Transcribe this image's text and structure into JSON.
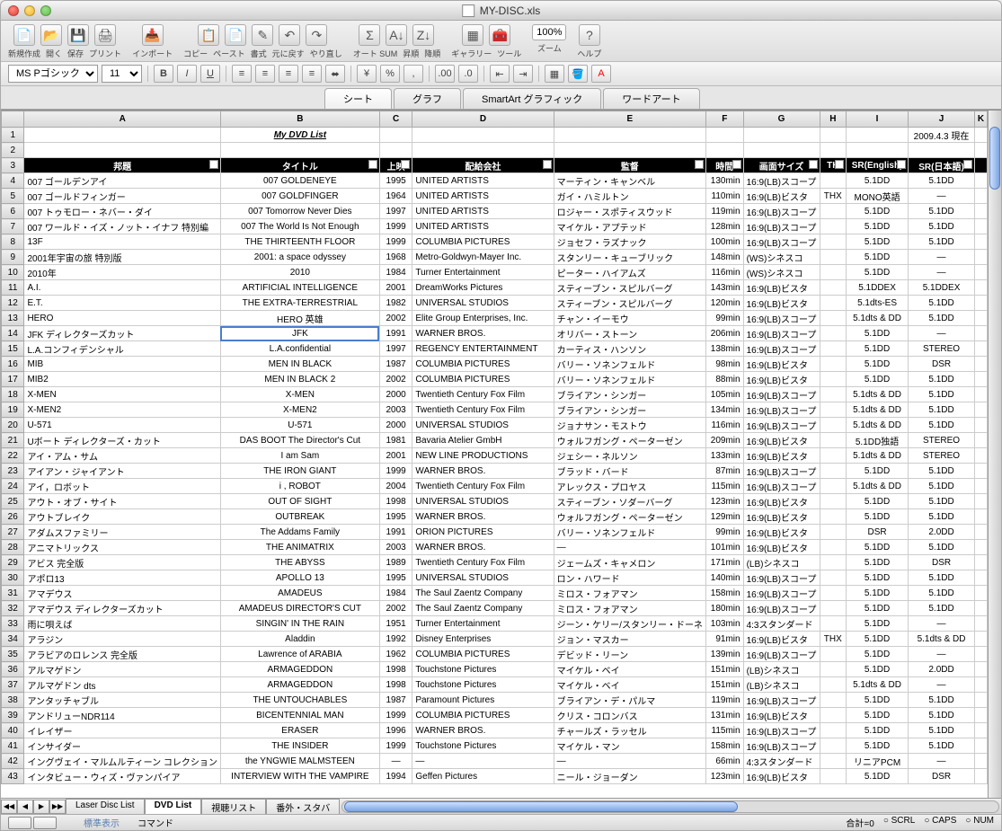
{
  "window": {
    "title": "MY-DISC.xls"
  },
  "toolbar": {
    "groups": [
      {
        "labels": [
          "新規作成",
          "開く",
          "保存",
          "プリント"
        ],
        "keys": [
          "new",
          "open",
          "save",
          "print"
        ]
      },
      {
        "labels": [
          "インポート"
        ],
        "keys": [
          "import"
        ]
      },
      {
        "labels": [
          "コピー",
          "ペースト",
          "書式",
          "元に戻す",
          "やり直し"
        ],
        "keys": [
          "copy",
          "paste",
          "format",
          "undo",
          "redo"
        ]
      },
      {
        "labels": [
          "オート SUM",
          "昇順",
          "降順"
        ],
        "keys": [
          "autosum",
          "asc",
          "desc"
        ]
      },
      {
        "labels": [
          "ギャラリー",
          "ツール"
        ],
        "keys": [
          "gallery",
          "tools"
        ]
      },
      {
        "labels": [
          "ズーム"
        ],
        "keys": [
          "zoom"
        ]
      },
      {
        "labels": [
          "ヘルプ"
        ],
        "keys": [
          "help"
        ]
      }
    ],
    "zoom": "100%"
  },
  "font": {
    "name": "MS Pゴシック",
    "size": "11"
  },
  "ribbontabs": [
    "シート",
    "グラフ",
    "SmartArt グラフィック",
    "ワードアート"
  ],
  "columns": [
    "",
    "A",
    "B",
    "C",
    "D",
    "E",
    "F",
    "G",
    "H",
    "I",
    "J",
    "K"
  ],
  "list_title": "My DVD List",
  "date": "2009.4.3 現在",
  "headers": [
    "邦題",
    "タイトル",
    "上映",
    "配給会社",
    "監督",
    "時間",
    "画面サイズ",
    "TH",
    "SR(English)",
    "SR(日本語)"
  ],
  "selected": {
    "row": 14,
    "col": "B"
  },
  "rows": [
    {
      "n": 4,
      "a": "007 ゴールデンアイ",
      "b": "007 GOLDENEYE",
      "c": "1995",
      "d": "UNITED ARTISTS",
      "e": "マーティン・キャンベル",
      "f": "130min",
      "g": "16:9(LB)スコープ",
      "h": "",
      "i": "5.1DD",
      "j": "5.1DD"
    },
    {
      "n": 5,
      "a": "007 ゴールドフィンガー",
      "b": "007 GOLDFINGER",
      "c": "1964",
      "d": "UNITED ARTISTS",
      "e": "ガイ・ハミルトン",
      "f": "110min",
      "g": "16:9(LB)ビスタ",
      "h": "THX",
      "i": "MONO英語",
      "j": "―"
    },
    {
      "n": 6,
      "a": "007 トゥモロー・ネバー・ダイ",
      "b": "007 Tomorrow Never Dies",
      "c": "1997",
      "d": "UNITED ARTISTS",
      "e": "ロジャー・スポティスウッド",
      "f": "119min",
      "g": "16:9(LB)スコープ",
      "h": "",
      "i": "5.1DD",
      "j": "5.1DD"
    },
    {
      "n": 7,
      "a": "007 ワールド・イズ・ノット・イナフ 特別編",
      "b": "007 The World Is Not Enough",
      "c": "1999",
      "d": "UNITED ARTISTS",
      "e": "マイケル・アプテッド",
      "f": "128min",
      "g": "16:9(LB)スコープ",
      "h": "",
      "i": "5.1DD",
      "j": "5.1DD"
    },
    {
      "n": 8,
      "a": "13F",
      "b": "THE THIRTEENTH FLOOR",
      "c": "1999",
      "d": "COLUMBIA PICTURES",
      "e": "ジョセフ・ラズナック",
      "f": "100min",
      "g": "16:9(LB)スコープ",
      "h": "",
      "i": "5.1DD",
      "j": "5.1DD"
    },
    {
      "n": 9,
      "a": "2001年宇宙の旅 特別版",
      "b": "2001: a space odyssey",
      "c": "1968",
      "d": "Metro-Goldwyn-Mayer Inc.",
      "e": "スタンリー・キューブリック",
      "f": "148min",
      "g": "(WS)シネスコ",
      "h": "",
      "i": "5.1DD",
      "j": "―"
    },
    {
      "n": 10,
      "a": "2010年",
      "b": "2010",
      "c": "1984",
      "d": "Turner Entertainment",
      "e": "ピーター・ハイアムズ",
      "f": "116min",
      "g": "(WS)シネスコ",
      "h": "",
      "i": "5.1DD",
      "j": "―"
    },
    {
      "n": 11,
      "a": "A.I.",
      "b": "ARTIFICIAL INTELLIGENCE",
      "c": "2001",
      "d": "DreamWorks Pictures",
      "e": "スティーブン・スピルバーグ",
      "f": "143min",
      "g": "16:9(LB)ビスタ",
      "h": "",
      "i": "5.1DDEX",
      "j": "5.1DDEX"
    },
    {
      "n": 12,
      "a": "E.T.",
      "b": "THE EXTRA-TERRESTRIAL",
      "c": "1982",
      "d": "UNIVERSAL STUDIOS",
      "e": "スティーブン・スピルバーグ",
      "f": "120min",
      "g": "16:9(LB)ビスタ",
      "h": "",
      "i": "5.1dts-ES",
      "j": "5.1DD"
    },
    {
      "n": 13,
      "a": "HERO",
      "b": "HERO 英雄",
      "c": "2002",
      "d": "Elite Group Enterprises, Inc.",
      "e": "チャン・イーモウ",
      "f": "99min",
      "g": "16:9(LB)スコープ",
      "h": "",
      "i": "5.1dts & DD",
      "j": "5.1DD"
    },
    {
      "n": 14,
      "a": "JFK ディレクターズカット",
      "b": "JFK",
      "c": "1991",
      "d": "WARNER BROS.",
      "e": "オリバー・ストーン",
      "f": "206min",
      "g": "16:9(LB)スコープ",
      "h": "",
      "i": "5.1DD",
      "j": "―"
    },
    {
      "n": 15,
      "a": "L.A.コンフィデンシャル",
      "b": "L.A.confidential",
      "c": "1997",
      "d": "REGENCY ENTERTAINMENT",
      "e": "カーティス・ハンソン",
      "f": "138min",
      "g": "16:9(LB)スコープ",
      "h": "",
      "i": "5.1DD",
      "j": "STEREO"
    },
    {
      "n": 16,
      "a": "MIB",
      "b": "MEN IN BLACK",
      "c": "1987",
      "d": "COLUMBIA PICTURES",
      "e": "バリー・ソネンフェルド",
      "f": "98min",
      "g": "16:9(LB)ビスタ",
      "h": "",
      "i": "5.1DD",
      "j": "DSR"
    },
    {
      "n": 17,
      "a": "MIB2",
      "b": "MEN IN BLACK 2",
      "c": "2002",
      "d": "COLUMBIA PICTURES",
      "e": "バリー・ソネンフェルド",
      "f": "88min",
      "g": "16:9(LB)ビスタ",
      "h": "",
      "i": "5.1DD",
      "j": "5.1DD"
    },
    {
      "n": 18,
      "a": "X-MEN",
      "b": "X-MEN",
      "c": "2000",
      "d": "Twentieth Century Fox Film",
      "e": "ブライアン・シンガー",
      "f": "105min",
      "g": "16:9(LB)スコープ",
      "h": "",
      "i": "5.1dts & DD",
      "j": "5.1DD"
    },
    {
      "n": 19,
      "a": "X-MEN2",
      "b": "X-MEN2",
      "c": "2003",
      "d": "Twentieth Century Fox Film",
      "e": "ブライアン・シンガー",
      "f": "134min",
      "g": "16:9(LB)スコープ",
      "h": "",
      "i": "5.1dts & DD",
      "j": "5.1DD"
    },
    {
      "n": 20,
      "a": "U-571",
      "b": "U-571",
      "c": "2000",
      "d": "UNIVERSAL STUDIOS",
      "e": "ジョナサン・モストウ",
      "f": "116min",
      "g": "16:9(LB)スコープ",
      "h": "",
      "i": "5.1dts & DD",
      "j": "5.1DD"
    },
    {
      "n": 21,
      "a": "Uボート ディレクターズ・カット",
      "b": "DAS BOOT The Director's Cut",
      "c": "1981",
      "d": "Bavaria Atelier GmbH",
      "e": "ウォルフガング・ペーターゼン",
      "f": "209min",
      "g": "16:9(LB)ビスタ",
      "h": "",
      "i": "5.1DD独語",
      "j": "STEREO"
    },
    {
      "n": 22,
      "a": "アイ・アム・サム",
      "b": "I am Sam",
      "c": "2001",
      "d": "NEW LINE PRODUCTIONS",
      "e": "ジェシー・ネルソン",
      "f": "133min",
      "g": "16:9(LB)ビスタ",
      "h": "",
      "i": "5.1dts & DD",
      "j": "STEREO"
    },
    {
      "n": 23,
      "a": "アイアン・ジャイアント",
      "b": "THE IRON GIANT",
      "c": "1999",
      "d": "WARNER BROS.",
      "e": "ブラッド・バード",
      "f": "87min",
      "g": "16:9(LB)スコープ",
      "h": "",
      "i": "5.1DD",
      "j": "5.1DD"
    },
    {
      "n": 24,
      "a": "アイ，ロボット",
      "b": "i , ROBOT",
      "c": "2004",
      "d": "Twentieth Century Fox Film",
      "e": "アレックス・プロヤス",
      "f": "115min",
      "g": "16:9(LB)スコープ",
      "h": "",
      "i": "5.1dts & DD",
      "j": "5.1DD"
    },
    {
      "n": 25,
      "a": "アウト・オブ・サイト",
      "b": "OUT OF SIGHT",
      "c": "1998",
      "d": "UNIVERSAL STUDIOS",
      "e": "スティーブン・ソダーバーグ",
      "f": "123min",
      "g": "16:9(LB)ビスタ",
      "h": "",
      "i": "5.1DD",
      "j": "5.1DD"
    },
    {
      "n": 26,
      "a": "アウトブレイク",
      "b": "OUTBREAK",
      "c": "1995",
      "d": "WARNER BROS.",
      "e": "ウォルフガング・ペーターゼン",
      "f": "129min",
      "g": "16:9(LB)ビスタ",
      "h": "",
      "i": "5.1DD",
      "j": "5.1DD"
    },
    {
      "n": 27,
      "a": "アダムスファミリー",
      "b": "The Addams Family",
      "c": "1991",
      "d": "ORION PICTURES",
      "e": "バリー・ソネンフェルド",
      "f": "99min",
      "g": "16:9(LB)ビスタ",
      "h": "",
      "i": "DSR",
      "j": "2.0DD"
    },
    {
      "n": 28,
      "a": "アニマトリックス",
      "b": "THE ANIMATRIX",
      "c": "2003",
      "d": "WARNER BROS.",
      "e": "―",
      "f": "101min",
      "g": "16:9(LB)ビスタ",
      "h": "",
      "i": "5.1DD",
      "j": "5.1DD"
    },
    {
      "n": 29,
      "a": "アビス 完全版",
      "b": "THE ABYSS",
      "c": "1989",
      "d": "Twentieth Century Fox Film",
      "e": "ジェームズ・キャメロン",
      "f": "171min",
      "g": "(LB)シネスコ",
      "h": "",
      "i": "5.1DD",
      "j": "DSR"
    },
    {
      "n": 30,
      "a": "アポロ13",
      "b": "APOLLO 13",
      "c": "1995",
      "d": "UNIVERSAL STUDIOS",
      "e": "ロン・ハワード",
      "f": "140min",
      "g": "16:9(LB)スコープ",
      "h": "",
      "i": "5.1DD",
      "j": "5.1DD"
    },
    {
      "n": 31,
      "a": "アマデウス",
      "b": "AMADEUS",
      "c": "1984",
      "d": "The Saul Zaentz Company",
      "e": "ミロス・フォアマン",
      "f": "158min",
      "g": "16:9(LB)スコープ",
      "h": "",
      "i": "5.1DD",
      "j": "5.1DD"
    },
    {
      "n": 32,
      "a": "アマデウス ディレクターズカット",
      "b": "AMADEUS DIRECTOR'S CUT",
      "c": "2002",
      "d": "The Saul Zaentz Company",
      "e": "ミロス・フォアマン",
      "f": "180min",
      "g": "16:9(LB)スコープ",
      "h": "",
      "i": "5.1DD",
      "j": "5.1DD"
    },
    {
      "n": 33,
      "a": "雨に唄えば",
      "b": "SINGIN' IN THE RAIN",
      "c": "1951",
      "d": "Turner Entertainment",
      "e": "ジーン・ケリー/スタンリー・ドーネ",
      "f": "103min",
      "g": "4:3スタンダード",
      "h": "",
      "i": "5.1DD",
      "j": "―"
    },
    {
      "n": 34,
      "a": "アラジン",
      "b": "Aladdin",
      "c": "1992",
      "d": "Disney Enterprises",
      "e": "ジョン・マスカー",
      "f": "91min",
      "g": "16:9(LB)ビスタ",
      "h": "THX",
      "i": "5.1DD",
      "j": "5.1dts & DD"
    },
    {
      "n": 35,
      "a": "アラビアのロレンス 完全版",
      "b": "Lawrence of ARABIA",
      "c": "1962",
      "d": "COLUMBIA PICTURES",
      "e": "デビッド・リーン",
      "f": "139min",
      "g": "16:9(LB)スコープ",
      "h": "",
      "i": "5.1DD",
      "j": "―"
    },
    {
      "n": 36,
      "a": "アルマゲドン",
      "b": "ARMAGEDDON",
      "c": "1998",
      "d": "Touchstone Pictures",
      "e": "マイケル・ベイ",
      "f": "151min",
      "g": "(LB)シネスコ",
      "h": "",
      "i": "5.1DD",
      "j": "2.0DD"
    },
    {
      "n": 37,
      "a": "アルマゲドン dts",
      "b": "ARMAGEDDON",
      "c": "1998",
      "d": "Touchstone Pictures",
      "e": "マイケル・ベイ",
      "f": "151min",
      "g": "(LB)シネスコ",
      "h": "",
      "i": "5.1dts & DD",
      "j": "―"
    },
    {
      "n": 38,
      "a": "アンタッチャブル",
      "b": "THE UNTOUCHABLES",
      "c": "1987",
      "d": "Paramount Pictures",
      "e": "ブライアン・デ・パルマ",
      "f": "119min",
      "g": "16:9(LB)スコープ",
      "h": "",
      "i": "5.1DD",
      "j": "5.1DD"
    },
    {
      "n": 39,
      "a": "アンドリューNDR114",
      "b": "BICENTENNIAL MAN",
      "c": "1999",
      "d": "COLUMBIA PICTURES",
      "e": "クリス・コロンバス",
      "f": "131min",
      "g": "16:9(LB)ビスタ",
      "h": "",
      "i": "5.1DD",
      "j": "5.1DD"
    },
    {
      "n": 40,
      "a": "イレイザー",
      "b": "ERASER",
      "c": "1996",
      "d": "WARNER BROS.",
      "e": "チャールズ・ラッセル",
      "f": "115min",
      "g": "16:9(LB)スコープ",
      "h": "",
      "i": "5.1DD",
      "j": "5.1DD"
    },
    {
      "n": 41,
      "a": "インサイダー",
      "b": "THE INSIDER",
      "c": "1999",
      "d": "Touchstone Pictures",
      "e": "マイケル・マン",
      "f": "158min",
      "g": "16:9(LB)スコープ",
      "h": "",
      "i": "5.1DD",
      "j": "5.1DD"
    },
    {
      "n": 42,
      "a": "イングヴェイ・マルムルティーン コレクション",
      "b": "the YNGWIE MALMSTEEN",
      "c": "―",
      "d": "―",
      "e": "―",
      "f": "66min",
      "g": "4:3スタンダード",
      "h": "",
      "i": "リニアPCM",
      "j": "―"
    },
    {
      "n": 43,
      "a": "インタビュー・ウィズ・ヴァンパイア",
      "b": "INTERVIEW WITH THE VAMPIRE",
      "c": "1994",
      "d": "Geffen Pictures",
      "e": "ニール・ジョーダン",
      "f": "123min",
      "g": "16:9(LB)ビスタ",
      "h": "",
      "i": "5.1DD",
      "j": "DSR"
    }
  ],
  "sheettabs": [
    "Laser Disc List",
    "DVD List",
    "視聴リスト",
    "番外・スタバ"
  ],
  "active_sheet": 1,
  "status": {
    "view": "標準表示",
    "cmd": "コマンド",
    "sum": "合計=0",
    "scrl": "SCRL",
    "caps": "CAPS",
    "num": "NUM"
  }
}
